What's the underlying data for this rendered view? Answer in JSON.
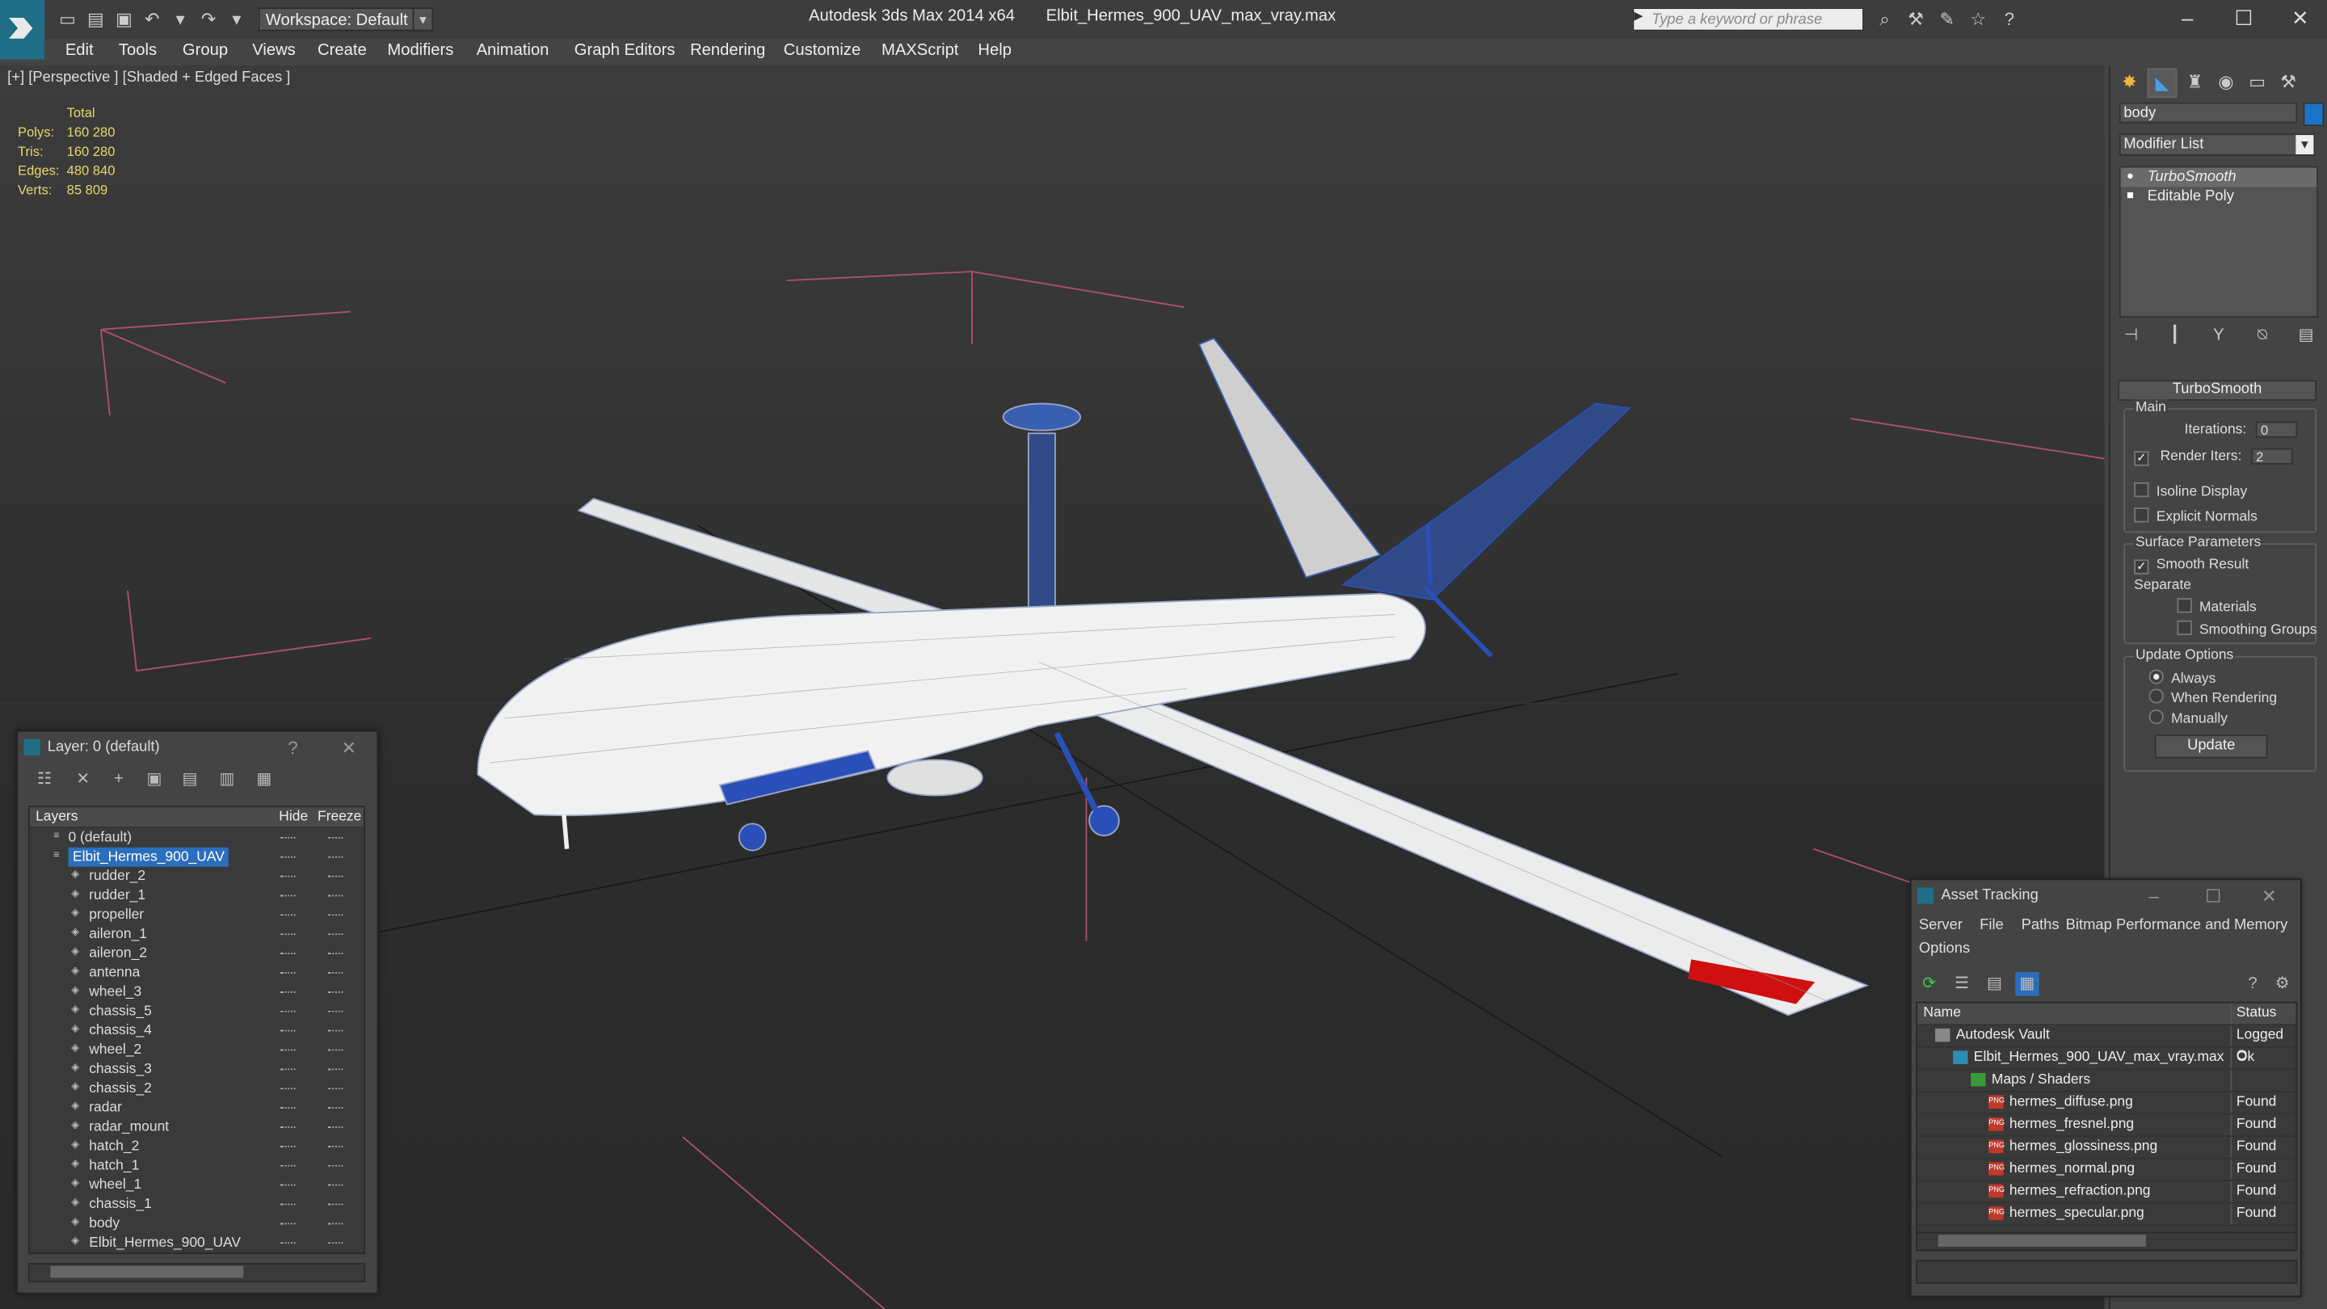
{
  "app": {
    "name": "Autodesk 3ds Max  2014 x64",
    "file": "Elbit_Hermes_900_UAV_max_vray.max",
    "workspace": "Workspace: Default",
    "search_placeholder": "Type a keyword or phrase"
  },
  "menu": [
    "Edit",
    "Tools",
    "Group",
    "Views",
    "Create",
    "Modifiers",
    "Animation",
    "Graph Editors",
    "Rendering",
    "Customize",
    "MAXScript",
    "Help"
  ],
  "viewport": {
    "label": "[+] [Perspective ] [Shaded + Edged Faces ]",
    "stats": {
      "header": "Total",
      "polys_label": "Polys:",
      "polys": "160 280",
      "tris_label": "Tris:",
      "tris": "160 280",
      "edges_label": "Edges:",
      "edges": "480 840",
      "verts_label": "Verts:",
      "verts": "85 809"
    }
  },
  "command_panel": {
    "object_name": "body",
    "object_color": "#1b74c9",
    "modifier_list_label": "Modifier List",
    "stack": [
      "TurboSmooth",
      "Editable Poly"
    ],
    "rollout_title": "TurboSmooth",
    "main_group": "Main",
    "iterations_label": "Iterations:",
    "iterations": "0",
    "render_iters_label": "Render Iters:",
    "render_iters": "2",
    "isoline_label": "Isoline Display",
    "explicit_normals_label": "Explicit Normals",
    "surface_group": "Surface Parameters",
    "smooth_result_label": "Smooth Result",
    "separate_label": "Separate",
    "materials_label": "Materials",
    "smoothing_groups_label": "Smoothing Groups",
    "update_group": "Update Options",
    "always_label": "Always",
    "when_rendering_label": "When Rendering",
    "manually_label": "Manually",
    "update_button": "Update"
  },
  "layer_window": {
    "title": "Layer: 0 (default)",
    "help": "?",
    "col_layers": "Layers",
    "col_hide": "Hide",
    "col_freeze": "Freeze",
    "layers": [
      {
        "name": "0 (default)",
        "level": 0
      },
      {
        "name": "Elbit_Hermes_900_UAV",
        "level": 0,
        "selected": true
      },
      {
        "name": "rudder_2",
        "level": 1
      },
      {
        "name": "rudder_1",
        "level": 1
      },
      {
        "name": "propeller",
        "level": 1
      },
      {
        "name": "aileron_1",
        "level": 1
      },
      {
        "name": "aileron_2",
        "level": 1
      },
      {
        "name": "antenna",
        "level": 1
      },
      {
        "name": "wheel_3",
        "level": 1
      },
      {
        "name": "chassis_5",
        "level": 1
      },
      {
        "name": "chassis_4",
        "level": 1
      },
      {
        "name": "wheel_2",
        "level": 1
      },
      {
        "name": "chassis_3",
        "level": 1
      },
      {
        "name": "chassis_2",
        "level": 1
      },
      {
        "name": "radar",
        "level": 1
      },
      {
        "name": "radar_mount",
        "level": 1
      },
      {
        "name": "hatch_2",
        "level": 1
      },
      {
        "name": "hatch_1",
        "level": 1
      },
      {
        "name": "wheel_1",
        "level": 1
      },
      {
        "name": "chassis_1",
        "level": 1
      },
      {
        "name": "body",
        "level": 1
      },
      {
        "name": "Elbit_Hermes_900_UAV",
        "level": 1
      }
    ]
  },
  "asset_window": {
    "title": "Asset Tracking",
    "menu": [
      "Server",
      "File",
      "Paths",
      "Bitmap Performance and Memory",
      "Options"
    ],
    "col_name": "Name",
    "col_status": "Status",
    "rows": [
      {
        "name": "Autodesk Vault",
        "status": "Logged O",
        "indent": 0,
        "icon": "vault"
      },
      {
        "name": "Elbit_Hermes_900_UAV_max_vray.max",
        "status": "Ok",
        "indent": 1,
        "icon": "max"
      },
      {
        "name": "Maps / Shaders",
        "status": "",
        "indent": 2,
        "icon": "maps"
      },
      {
        "name": "hermes_diffuse.png",
        "status": "Found",
        "indent": 3,
        "icon": "png"
      },
      {
        "name": "hermes_fresnel.png",
        "status": "Found",
        "indent": 3,
        "icon": "png"
      },
      {
        "name": "hermes_glossiness.png",
        "status": "Found",
        "indent": 3,
        "icon": "png"
      },
      {
        "name": "hermes_normal.png",
        "status": "Found",
        "indent": 3,
        "icon": "png"
      },
      {
        "name": "hermes_refraction.png",
        "status": "Found",
        "indent": 3,
        "icon": "png"
      },
      {
        "name": "hermes_specular.png",
        "status": "Found",
        "indent": 3,
        "icon": "png"
      }
    ]
  }
}
